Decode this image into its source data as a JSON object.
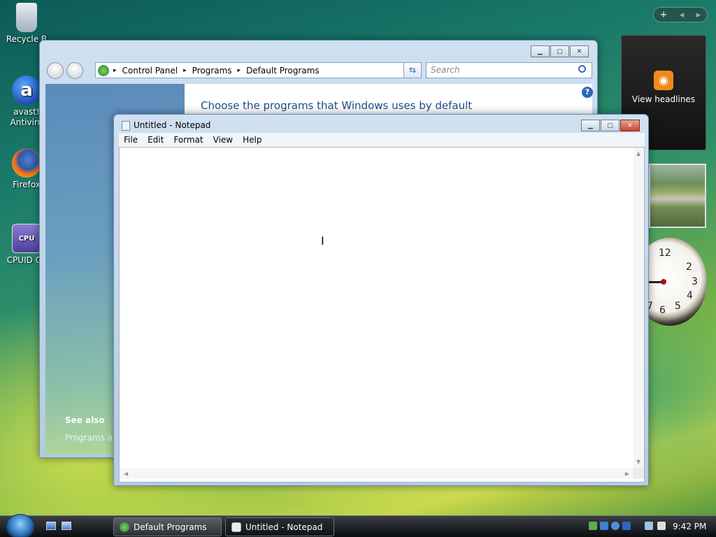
{
  "desktop": {
    "icons": [
      {
        "label": "Recycle B",
        "icon": "recycle-bin-icon"
      },
      {
        "label": "avast!\nAntiviru",
        "icon": "avast-icon"
      },
      {
        "label": "Firefox",
        "icon": "firefox-icon"
      },
      {
        "label": "CPUID CP",
        "icon": "cpuid-icon"
      }
    ]
  },
  "sidebar": {
    "feed_label": "View headlines",
    "plus": "+",
    "prev": "◂",
    "next": "▸",
    "clock_numbers": [
      "12",
      "2",
      "3",
      "4",
      "5",
      "6",
      "7"
    ]
  },
  "control_panel": {
    "breadcrumb": [
      "Control Panel",
      "Programs",
      "Default Programs"
    ],
    "search_placeholder": "Search",
    "heading": "Choose the programs that Windows uses by default",
    "see_also": "See also",
    "see_also_item": "Programs anc",
    "help": "?"
  },
  "notepad": {
    "title": "Untitled - Notepad",
    "menu": [
      "File",
      "Edit",
      "Format",
      "View",
      "Help"
    ],
    "content": ""
  },
  "taskbar": {
    "tasks": [
      {
        "label": "Default Programs",
        "icon": "control-panel-icon"
      },
      {
        "label": "Untitled - Notepad",
        "icon": "notepad-icon"
      }
    ],
    "time": "9:42 PM"
  },
  "colors": {
    "accent": "#1a4b8c",
    "rss": "#f08a1c"
  }
}
